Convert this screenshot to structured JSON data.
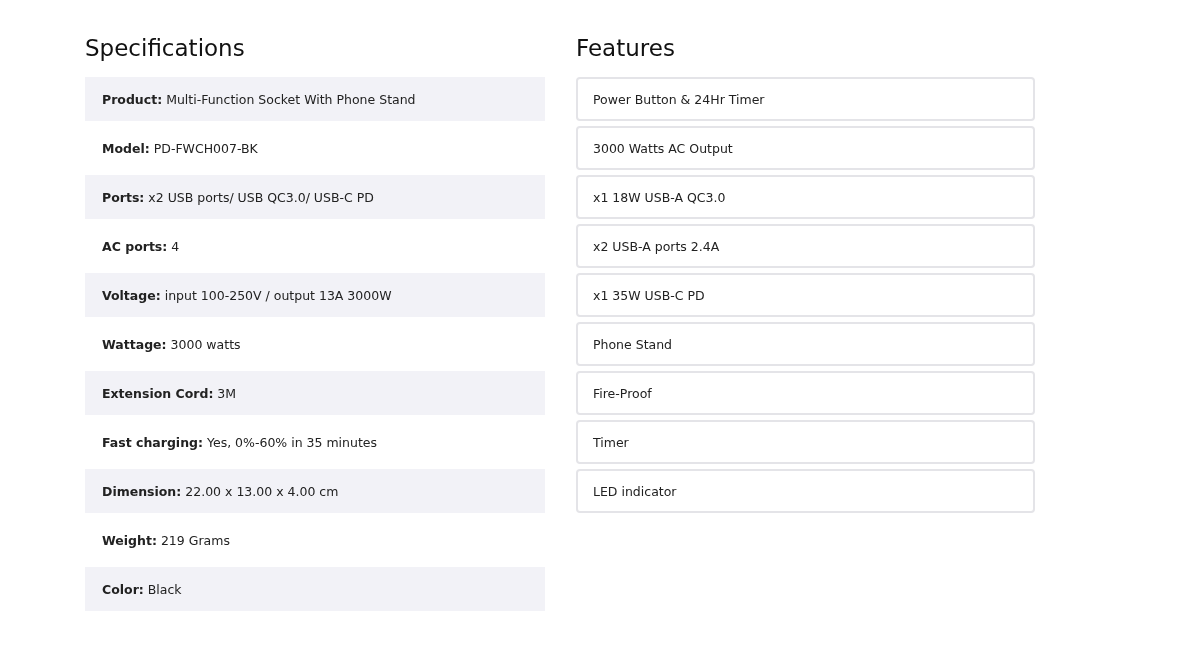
{
  "specifications": {
    "title": "Specifications",
    "rows": [
      {
        "label": "Product:",
        "value": "Multi-Function Socket With Phone Stand"
      },
      {
        "label": "Model:",
        "value": "PD-FWCH007-BK"
      },
      {
        "label": "Ports:",
        "value": "x2 USB ports/ USB QC3.0/ USB-C PD"
      },
      {
        "label": "AC ports:",
        "value": "4"
      },
      {
        "label": "Voltage:",
        "value": "input 100-250V / output 13A 3000W"
      },
      {
        "label": "Wattage:",
        "value": "3000 watts"
      },
      {
        "label": "Extension Cord:",
        "value": "3M"
      },
      {
        "label": "Fast charging:",
        "value": "Yes, 0%-60% in 35 minutes"
      },
      {
        "label": "Dimension:",
        "value": "22.00 x 13.00 x 4.00 cm"
      },
      {
        "label": "Weight:",
        "value": "219 Grams"
      },
      {
        "label": "Color:",
        "value": "Black"
      }
    ]
  },
  "features": {
    "title": "Features",
    "items": [
      "Power Button & 24Hr Timer",
      "3000 Watts AC Output",
      "x1 18W USB-A QC3.0",
      "x2 USB-A ports 2.4A",
      "x1 35W USB-C PD",
      "Phone Stand",
      "Fire-Proof",
      "Timer",
      "LED indicator"
    ]
  }
}
